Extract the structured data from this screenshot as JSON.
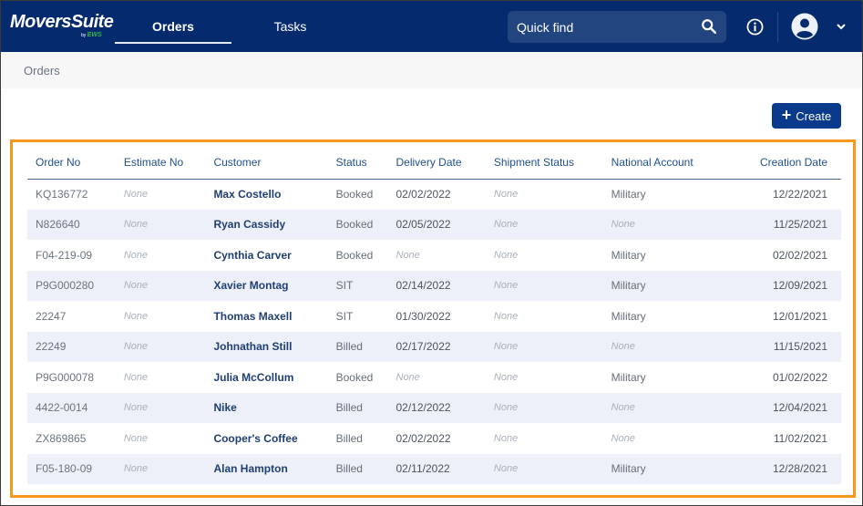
{
  "header": {
    "logo": "MoversSuite",
    "logo_by": "by",
    "logo_ews": "EWS",
    "tabs": [
      {
        "label": "Orders",
        "active": true
      },
      {
        "label": "Tasks",
        "active": false
      }
    ],
    "search_placeholder": "Quick find",
    "icons": [
      "search-icon",
      "info-icon",
      "user-avatar-icon",
      "chevron-down-icon"
    ]
  },
  "breadcrumb": "Orders",
  "toolbar": {
    "create_label": "Create"
  },
  "table": {
    "columns": [
      "Order No",
      "Estimate No",
      "Customer",
      "Status",
      "Delivery Date",
      "Shipment Status",
      "National Account",
      "Creation Date"
    ],
    "rows": [
      [
        "KQ136772",
        "None",
        "Max Costello",
        "Booked",
        "02/02/2022",
        "None",
        "Military",
        "12/22/2021"
      ],
      [
        "N826640",
        "None",
        "Ryan Cassidy",
        "Booked",
        "02/05/2022",
        "None",
        "None",
        "11/25/2021"
      ],
      [
        "F04-219-09",
        "None",
        "Cynthia Carver",
        "Booked",
        "None",
        "None",
        "Military",
        "02/02/2021"
      ],
      [
        "P9G000280",
        "None",
        "Xavier Montag",
        "SIT",
        "02/14/2022",
        "None",
        "Military",
        "12/09/2021"
      ],
      [
        "22247",
        "None",
        "Thomas Maxell",
        "SIT",
        "01/30/2022",
        "None",
        "Military",
        "12/01/2021"
      ],
      [
        "22249",
        "None",
        "Johnathan Still",
        "Billed",
        "02/17/2022",
        "None",
        "None",
        "11/15/2021"
      ],
      [
        "P9G000078",
        "None",
        "Julia McCollum",
        "Booked",
        "None",
        "None",
        "Military",
        "01/02/2022"
      ],
      [
        "4422-0014",
        "None",
        "Nike",
        "Billed",
        "02/12/2022",
        "None",
        "None",
        "12/04/2021"
      ],
      [
        "ZX869865",
        "None",
        "Cooper's Coffee",
        "Billed",
        "02/02/2022",
        "None",
        "None",
        "11/02/2021"
      ],
      [
        "F05-180-09",
        "None",
        "Alan Hampton",
        "Billed",
        "02/11/2022",
        "None",
        "Military",
        "12/28/2021"
      ]
    ]
  },
  "colors": {
    "topbar": "#052b6e",
    "accent": "#0a3a8c",
    "highlight": "#f7981d",
    "row_alt": "#edf0f8"
  }
}
